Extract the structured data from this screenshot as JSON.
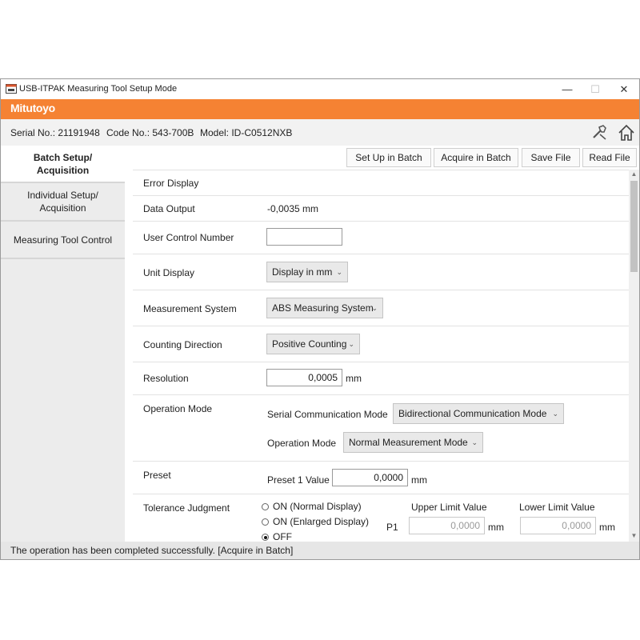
{
  "window": {
    "title": "USB-ITPAK Measuring Tool Setup Mode",
    "minimize_symbol": "—",
    "maximize_symbol": "☐",
    "close_symbol": "✕"
  },
  "brand": {
    "logo_text": "Mitutoyo",
    "color": "#f58233"
  },
  "device_info": {
    "serial": "Serial No.: 21191948",
    "code": "Code No.: 543-700B",
    "model": "Model: ID-C0512NXB"
  },
  "icons": {
    "tools": "tools-icon",
    "home": "home-icon"
  },
  "sidebar": {
    "items": [
      {
        "label_line1": "Batch Setup/",
        "label_line2": "Acquisition",
        "active": true
      },
      {
        "label_line1": "Individual Setup/",
        "label_line2": "Acquisition",
        "active": false
      },
      {
        "label_line1": "Measuring Tool Control",
        "label_line2": "",
        "active": false
      }
    ]
  },
  "toolbar": {
    "setup_batch": "Set Up in Batch",
    "acquire_batch": "Acquire in Batch",
    "save_file": "Save File",
    "read_file": "Read File"
  },
  "settings": {
    "error_display": {
      "label": "Error Display"
    },
    "data_output": {
      "label": "Data Output",
      "value": "-0,0035 mm"
    },
    "user_control_number": {
      "label": "User Control Number",
      "value": ""
    },
    "unit_display": {
      "label": "Unit Display",
      "selected": "Display in mm"
    },
    "measurement_system": {
      "label": "Measurement System",
      "selected": "ABS Measuring System"
    },
    "counting_direction": {
      "label": "Counting Direction",
      "selected": "Positive Counting"
    },
    "resolution": {
      "label": "Resolution",
      "value": "0,0005",
      "unit": "mm"
    },
    "operation_mode": {
      "label": "Operation Mode",
      "serial_comm_label": "Serial Communication Mode",
      "serial_comm_selected": "Bidirectional Communication Mode",
      "op_mode_label": "Operation Mode",
      "op_mode_selected": "Normal Measurement Mode"
    },
    "preset": {
      "label": "Preset",
      "preset1_label": "Preset 1 Value",
      "preset1_value": "0,0000",
      "unit": "mm"
    },
    "tolerance": {
      "label": "Tolerance Judgment",
      "options": [
        "ON (Normal Display)",
        "ON (Enlarged Display)",
        "OFF"
      ],
      "selected_index": 2,
      "upper_label": "Upper Limit Value",
      "lower_label": "Lower Limit Value",
      "p1_label": "P1",
      "upper_value": "0,0000",
      "lower_value": "0,0000",
      "unit": "mm"
    }
  },
  "status": {
    "message": "The operation has been completed successfully. [Acquire in Batch]"
  }
}
